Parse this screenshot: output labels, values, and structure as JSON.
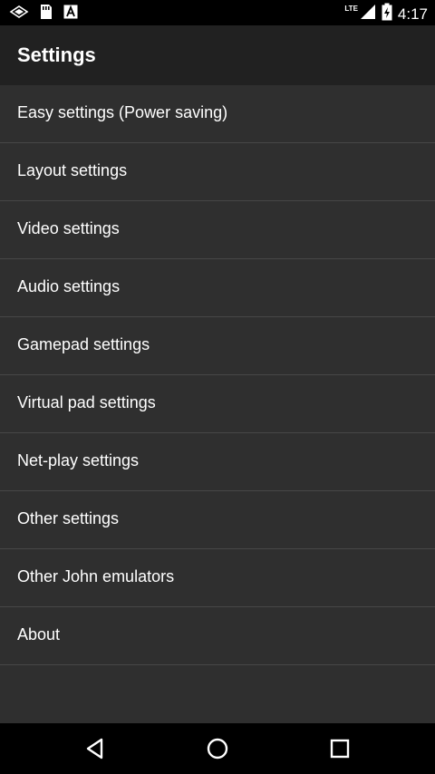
{
  "status_bar": {
    "time": "4:17",
    "network": "LTE",
    "icons": [
      "wifi-calling-icon",
      "sd-card-icon",
      "text-icon",
      "signal-icon",
      "battery-icon"
    ]
  },
  "app_bar": {
    "title": "Settings"
  },
  "settings_list": [
    {
      "label": "Easy settings (Power saving)"
    },
    {
      "label": "Layout settings"
    },
    {
      "label": "Video settings"
    },
    {
      "label": "Audio settings"
    },
    {
      "label": "Gamepad settings"
    },
    {
      "label": "Virtual pad settings"
    },
    {
      "label": "Net-play settings"
    },
    {
      "label": "Other settings"
    },
    {
      "label": "Other John emulators"
    },
    {
      "label": "About"
    }
  ],
  "nav_bar": {
    "buttons": [
      "back-icon",
      "home-icon",
      "recents-icon"
    ]
  },
  "colors": {
    "background": "#2f2f2f",
    "app_bar": "#212121",
    "divider": "#474747",
    "text": "#ffffff",
    "system_bars": "#000000"
  }
}
